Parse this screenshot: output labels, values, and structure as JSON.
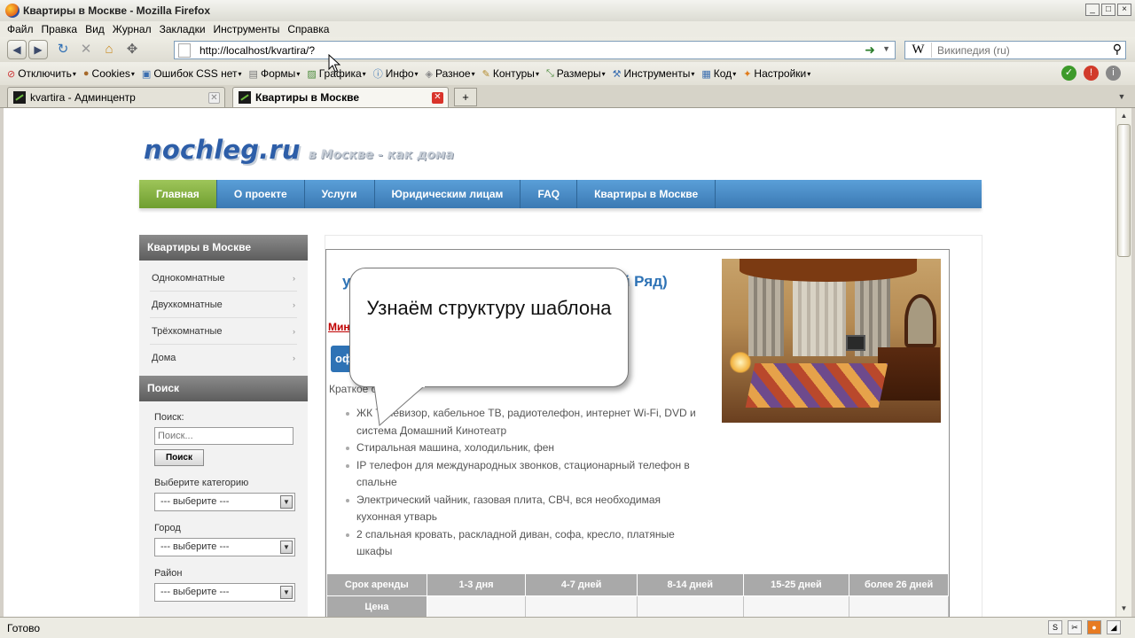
{
  "window": {
    "title": "Квартиры в Москве - Mozilla Firefox",
    "controls": [
      "_",
      "□",
      "×"
    ]
  },
  "menu": [
    "Файл",
    "Правка",
    "Вид",
    "Журнал",
    "Закладки",
    "Инструменты",
    "Справка"
  ],
  "navigation": {
    "url": "http://localhost/kvartira/?",
    "search_placeholder": "Википедия (ru)",
    "search_engine_glyph": "W"
  },
  "webdev_toolbar": [
    "Отключить",
    "Cookies",
    "Ошибок CSS нет",
    "Формы",
    "Графика",
    "Инфо",
    "Разное",
    "Контуры",
    "Размеры",
    "Инструменты",
    "Код",
    "Настройки"
  ],
  "tabs": [
    {
      "label": "kvartira - Админцентр",
      "active": false
    },
    {
      "label": "Квартиры в Москве",
      "active": true
    }
  ],
  "site": {
    "logo": "nochleg.ru",
    "slogan": "в Москве - как дома",
    "nav": [
      {
        "label": "Главная",
        "active": true
      },
      {
        "label": "О проекте",
        "active": false
      },
      {
        "label": "Услуги",
        "active": false
      },
      {
        "label": "Юридическим лицам",
        "active": false
      },
      {
        "label": "FAQ",
        "active": false
      },
      {
        "label": "Квартиры в Москве",
        "active": false
      }
    ],
    "sidebar": {
      "menu_title": "Квартиры в Москве",
      "menu_items": [
        "Однокомнатные",
        "Двухкомнатные",
        "Трёхкомнатные",
        "Дома"
      ],
      "search_title": "Поиск",
      "search_label": "Поиск:",
      "search_placeholder": "Поиск...",
      "search_button": "Поиск",
      "category_label": "Выберите категорию",
      "city_label": "Город",
      "district_label": "Район",
      "select_default": "--- выберите ---"
    },
    "listing": {
      "title_start": "у",
      "title_end": "й Ряд)",
      "metro": "Мин",
      "badge": "оф",
      "short_label": "Краткое опи",
      "features": [
        "ЖК Телевизор, кабельное ТВ, радиотелефон, интернет Wi-Fi, DVD и система Домашний Кинотеатр",
        "Стиральная машина, холодильник, фен",
        "IP телефон для международных звонков, стационарный телефон в спальне",
        "Электрический чайник,  газовая плита, СВЧ, вся необходимая кухонная утварь",
        "2 спальная кровать, раскладной диван, софа, кресло, платяные шкафы"
      ],
      "rent_table": {
        "header": [
          "Срок аренды",
          "1-3 дня",
          "4-7 дней",
          "8-14 дней",
          "15-25 дней",
          "более 26 дней"
        ],
        "price_label": "Цена",
        "prices": [
          "",
          "",
          "",
          "",
          ""
        ]
      }
    }
  },
  "callout_text": "Узнаём структуру шаблона",
  "status": "Готово",
  "colors": {
    "nav_blue": "#4a8cc6",
    "nav_active_green": "#86b346",
    "logo_blue": "#2d5ea8",
    "title_blue": "#2d72b5",
    "metro_red": "#c00000"
  }
}
